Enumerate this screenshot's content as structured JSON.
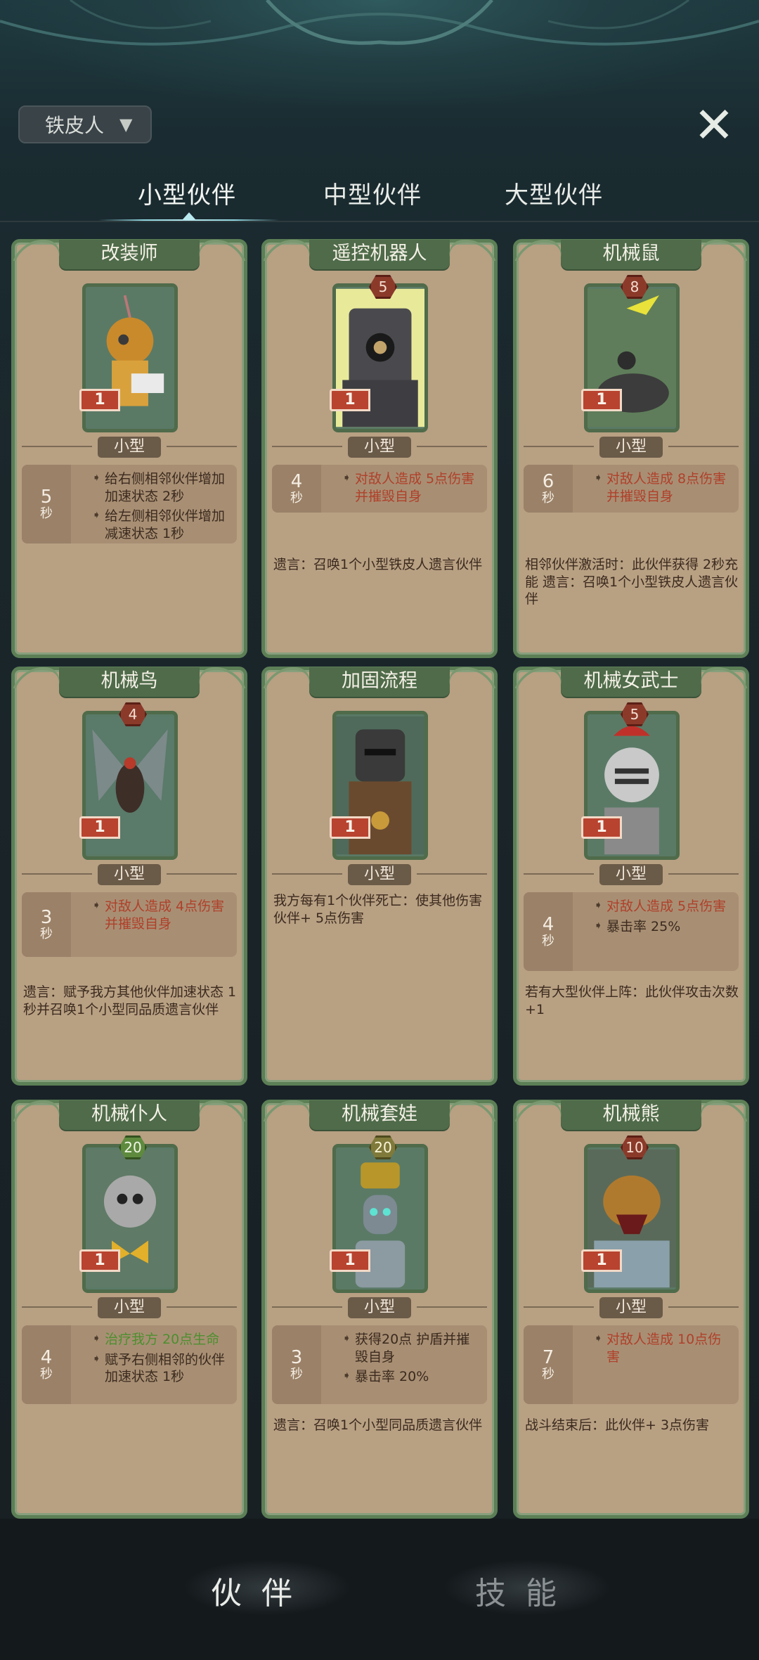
{
  "filter": {
    "label": "铁皮人",
    "icon": "funnel-icon"
  },
  "close_icon": "close-icon",
  "tabs": [
    {
      "label": "小型伙伴"
    },
    {
      "label": "中型伙伴"
    },
    {
      "label": "大型伙伴"
    }
  ],
  "cards": [
    {
      "name": "改装师",
      "cost": "",
      "level": "1",
      "size": "小型",
      "timer": "5",
      "timer_unit": "秒",
      "effects": [
        [
          "➜ ",
          "给右侧相邻伙伴增加",
          "加速",
          "状态",
          " 2秒"
        ],
        [
          "",
          "给左侧相邻伙伴增加",
          "减速",
          "状态",
          " 1秒"
        ]
      ],
      "effect_texts": [
        "给右侧相邻伙伴增加加速状态 2秒",
        "给左侧相邻伙伴增加减速状态 1秒"
      ],
      "extra": ""
    },
    {
      "name": "遥控机器人",
      "cost": "5",
      "level": "1",
      "size": "小型",
      "timer": "4",
      "timer_unit": "秒",
      "effect_texts": [
        "对敌人造成 5点伤害并摧毁自身"
      ],
      "extra": "遗言：召唤1个小型铁皮人遗言伙伴"
    },
    {
      "name": "机械鼠",
      "cost": "8",
      "level": "1",
      "size": "小型",
      "timer": "6",
      "timer_unit": "秒",
      "effect_texts": [
        "对敌人造成 8点伤害并摧毁自身"
      ],
      "extra": "相邻伙伴激活时：此伙伴获得 2秒充能 遗言：召唤1个小型铁皮人遗言伙伴"
    },
    {
      "name": "机械鸟",
      "cost": "4",
      "level": "1",
      "size": "小型",
      "timer": "3",
      "timer_unit": "秒",
      "effect_texts": [
        "对敌人造成 4点伤害并摧毁自身"
      ],
      "extra": "遗言：赋予我方其他伙伴加速状态 1秒并召唤1个小型同品质遗言伙伴"
    },
    {
      "name": "加固流程",
      "cost": "",
      "level": "1",
      "size": "小型",
      "timer": "",
      "timer_unit": "",
      "effect_texts": [],
      "extra": "我方每有1个伙伴死亡：使其他伤害伙伴+ 5点伤害"
    },
    {
      "name": "机械女武士",
      "cost": "5",
      "level": "1",
      "size": "小型",
      "timer": "4",
      "timer_unit": "秒",
      "effect_texts": [
        "对敌人造成 5点伤害",
        "暴击率 25%"
      ],
      "extra": "若有大型伙伴上阵：此伙伴攻击次数+1"
    },
    {
      "name": "机械仆人",
      "cost": "20",
      "level": "1",
      "size": "小型",
      "timer": "4",
      "timer_unit": "秒",
      "effect_texts": [
        "治疗我方 20点生命",
        "赋予右侧相邻的伙伴加速状态 1秒"
      ],
      "extra": ""
    },
    {
      "name": "机械套娃",
      "cost": "20",
      "level": "1",
      "size": "小型",
      "timer": "3",
      "timer_unit": "秒",
      "effect_texts": [
        "获得20点 护盾并摧毁自身",
        "暴击率 20%"
      ],
      "extra": "遗言：召唤1个小型同品质遗言伙伴"
    },
    {
      "name": "机械熊",
      "cost": "10",
      "level": "1",
      "size": "小型",
      "timer": "7",
      "timer_unit": "秒",
      "effect_texts": [
        "对敌人造成 10点伤害"
      ],
      "extra": "战斗结束后：此伙伴+ 3点伤害"
    }
  ],
  "bottom_nav": [
    {
      "label": "伙伴"
    },
    {
      "label": "技能"
    }
  ]
}
